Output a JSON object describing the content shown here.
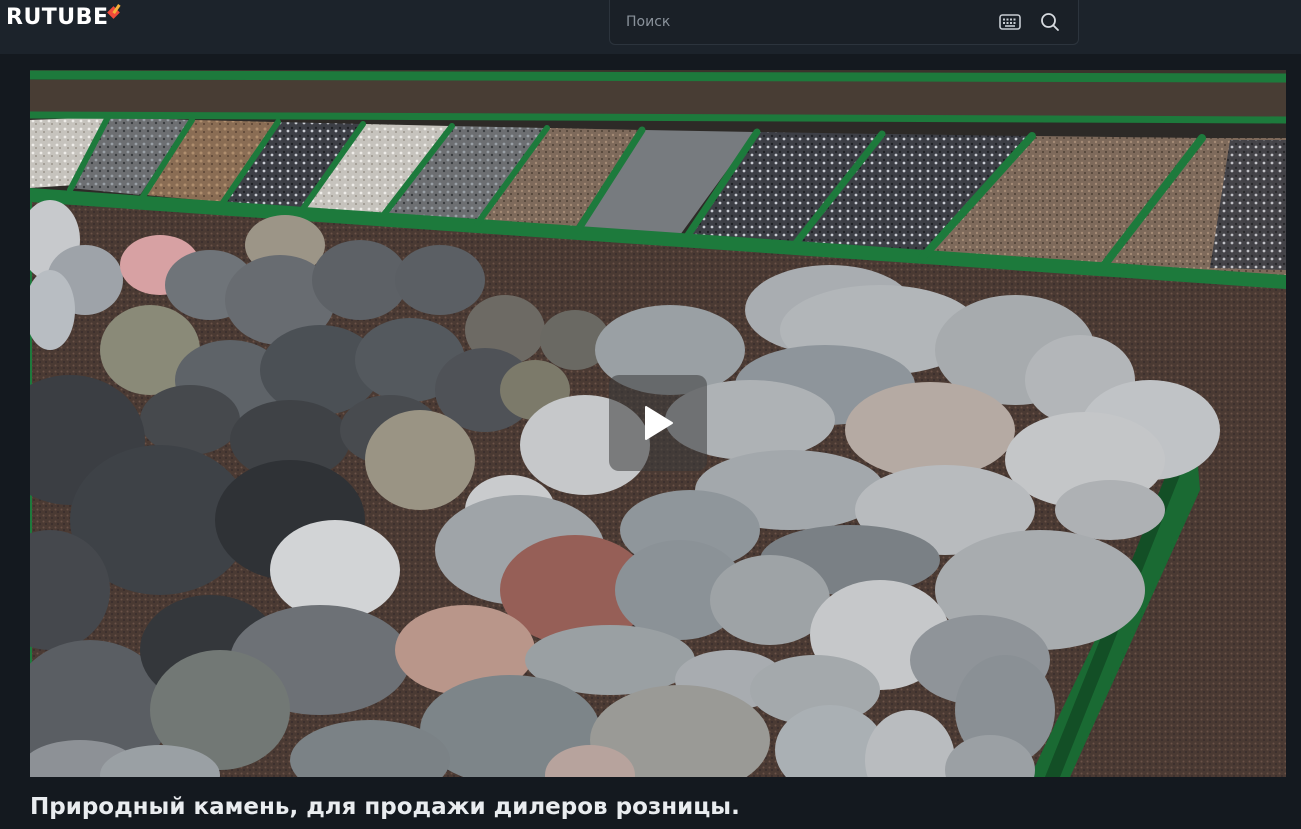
{
  "header": {
    "logo_text": "RUTUBE",
    "search": {
      "placeholder": "Поиск",
      "value": ""
    },
    "icons": [
      "keyboard-icon",
      "search-icon"
    ]
  },
  "player": {
    "state": "paused",
    "icons": [
      "play-icon"
    ]
  },
  "video": {
    "title": "Природный камень, для продажи дилеров розницы."
  },
  "colors": {
    "background": "#14191f",
    "header": "#1c232b",
    "brand_red": "#f04a3a",
    "text": "#e9ecef"
  }
}
